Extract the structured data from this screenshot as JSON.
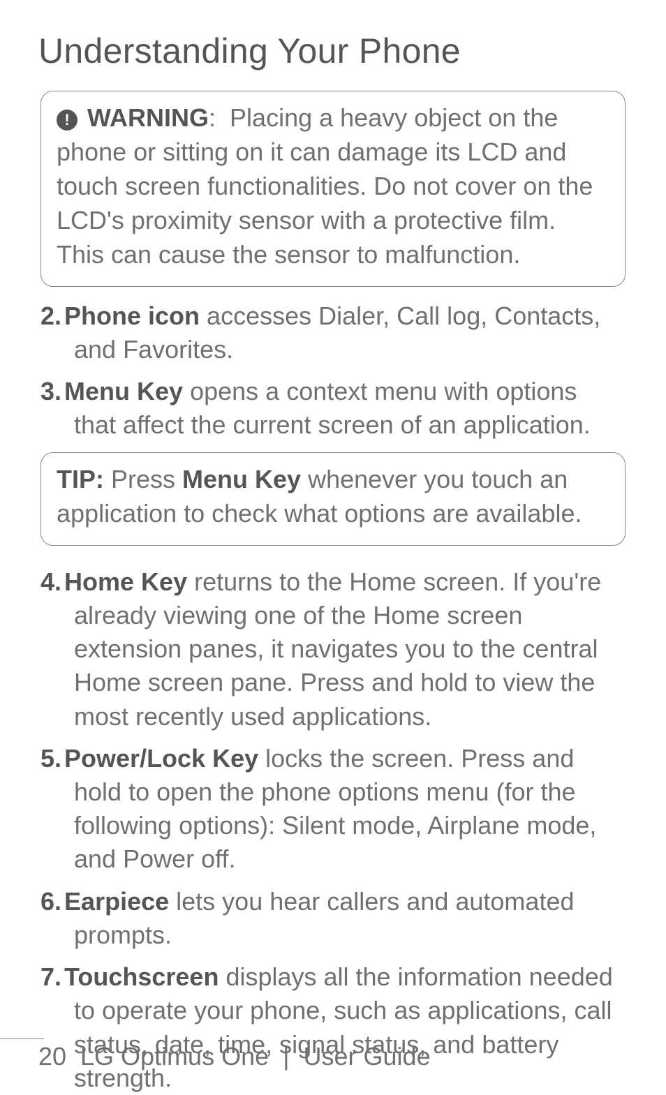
{
  "title": "Understanding Your Phone",
  "warning": {
    "label": "WARNING",
    "text": "Placing a heavy object on the phone or sitting on it can damage its LCD and touch screen functionalities. Do not cover on the LCD's proximity sensor with a protective film. This can cause the sensor to malfunction."
  },
  "items": [
    {
      "num": "2.",
      "bold": "Phone icon",
      "rest": " accesses Dialer, Call log, Contacts, and Favorites."
    },
    {
      "num": "3.",
      "bold": "Menu Key",
      "rest": " opens a context menu with options that affect the current screen of an application."
    }
  ],
  "tip": {
    "label": "TIP:",
    "pre": " Press ",
    "bold": "Menu Key",
    "post": " whenever you touch an application to check what options are available."
  },
  "items2": [
    {
      "num": "4.",
      "bold": "Home Key",
      "rest": " returns to the Home screen. If you're already viewing one of the Home screen extension panes, it navigates you to the central Home screen pane. Press and hold to view the most recently used applications."
    },
    {
      "num": "5.",
      "bold": "Power/Lock Key",
      "rest": " locks the screen. Press and hold to open the phone options menu (for the following options): Silent mode, Airplane mode, and Power off."
    },
    {
      "num": "6.",
      "bold": "Earpiece",
      "rest": " lets you hear callers and automated prompts."
    },
    {
      "num": "7.",
      "bold": "Touchscreen",
      "rest": " displays all the information needed to operate your phone, such as applications, call status, date, time, signal status, and battery strength."
    }
  ],
  "footer": {
    "page": "20",
    "product": "LG Optimus One",
    "doc": "User Guide"
  }
}
